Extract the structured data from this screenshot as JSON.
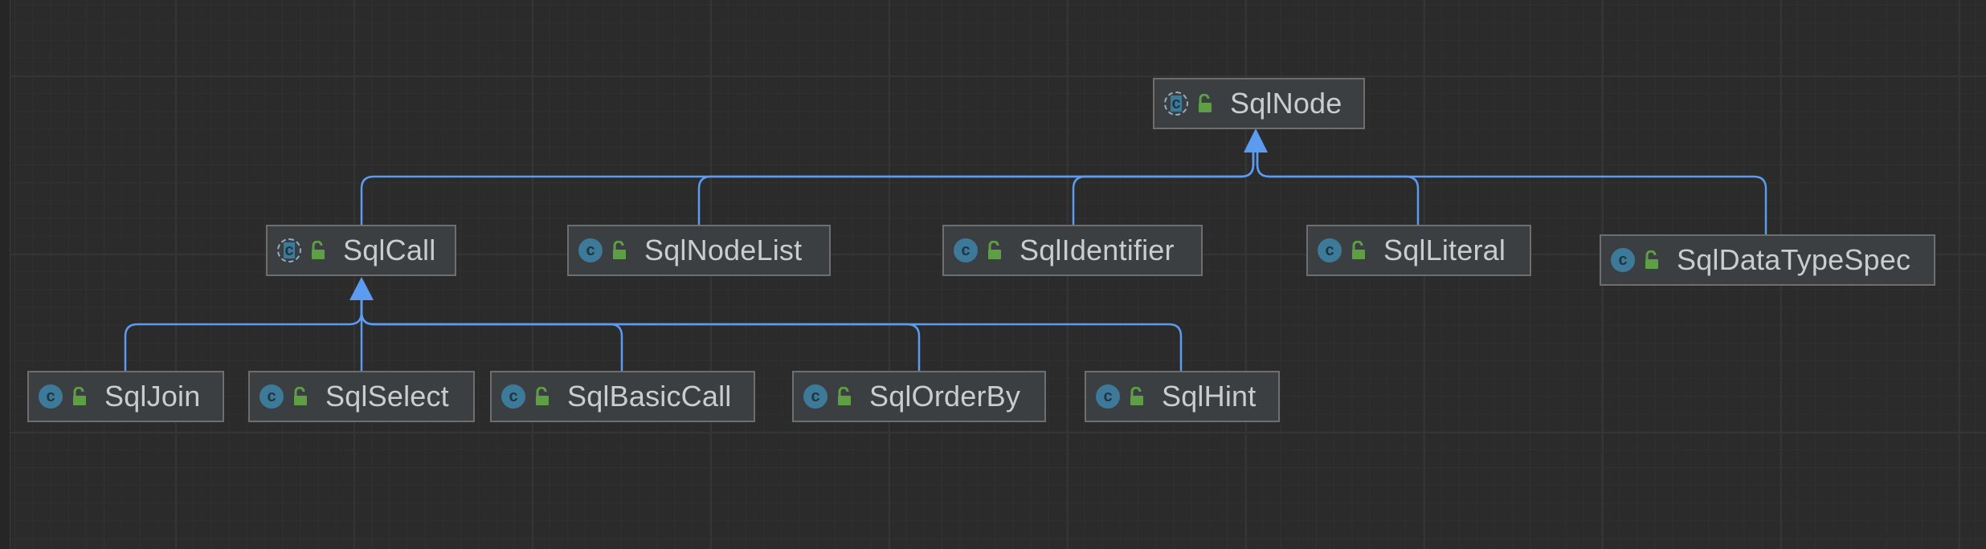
{
  "diagram": {
    "nodes": {
      "sqlnode": {
        "label": "SqlNode",
        "kind": "abstract-class"
      },
      "sqlcall": {
        "label": "SqlCall",
        "kind": "abstract-class"
      },
      "sqlnodelist": {
        "label": "SqlNodeList",
        "kind": "class"
      },
      "sqlidentifier": {
        "label": "SqlIdentifier",
        "kind": "class"
      },
      "sqlliteral": {
        "label": "SqlLiteral",
        "kind": "class"
      },
      "sqldatatypespec": {
        "label": "SqlDataTypeSpec",
        "kind": "class"
      },
      "sqljoin": {
        "label": "SqlJoin",
        "kind": "class"
      },
      "sqlselect": {
        "label": "SqlSelect",
        "kind": "class"
      },
      "sqlbasiccall": {
        "label": "SqlBasicCall",
        "kind": "class"
      },
      "sqlorderby": {
        "label": "SqlOrderBy",
        "kind": "class"
      },
      "sqlhint": {
        "label": "SqlHint",
        "kind": "class"
      }
    },
    "edges": [
      {
        "from": "sqlcall",
        "to": "sqlnode",
        "type": "extends"
      },
      {
        "from": "sqlnodelist",
        "to": "sqlnode",
        "type": "extends"
      },
      {
        "from": "sqlidentifier",
        "to": "sqlnode",
        "type": "extends"
      },
      {
        "from": "sqlliteral",
        "to": "sqlnode",
        "type": "extends"
      },
      {
        "from": "sqldatatypespec",
        "to": "sqlnode",
        "type": "extends"
      },
      {
        "from": "sqljoin",
        "to": "sqlcall",
        "type": "extends"
      },
      {
        "from": "sqlselect",
        "to": "sqlcall",
        "type": "extends"
      },
      {
        "from": "sqlbasiccall",
        "to": "sqlcall",
        "type": "extends"
      },
      {
        "from": "sqlorderby",
        "to": "sqlcall",
        "type": "extends"
      },
      {
        "from": "sqlhint",
        "to": "sqlcall",
        "type": "extends"
      }
    ],
    "icons": {
      "class_icon_letter": "c",
      "class_icon_color": "#3d7a99",
      "visibility_icon": "unlocked-public-icon",
      "visibility_icon_color": "#5e9f45"
    },
    "colors": {
      "background": "#2b2b2b",
      "node_fill": "#3c3f41",
      "node_border": "#6e6e6e",
      "edge": "#5c9cf0",
      "text": "#c9ccd0"
    }
  }
}
